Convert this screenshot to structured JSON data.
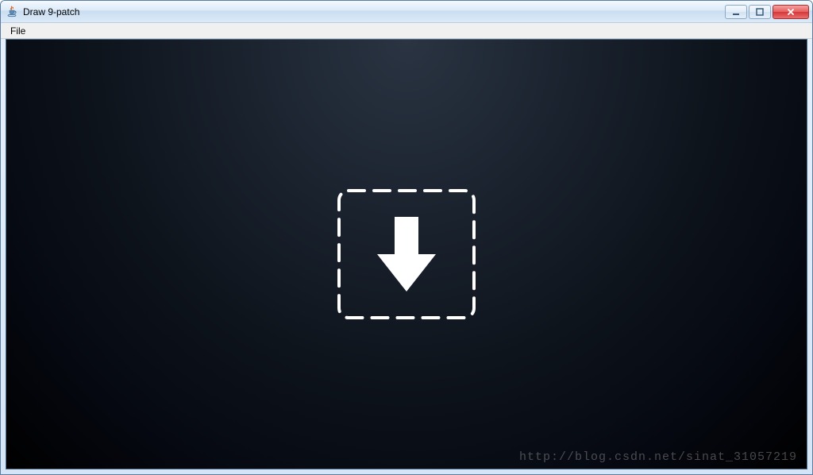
{
  "window": {
    "title": "Draw 9-patch"
  },
  "menu": {
    "file": "File"
  },
  "icons": {
    "app": "java-cup-icon",
    "minimize": "minimize-icon",
    "maximize": "maximize-icon",
    "close": "close-icon",
    "dropArrow": "download-arrow-icon"
  },
  "watermark": "http://blog.csdn.net/sinat_31057219"
}
